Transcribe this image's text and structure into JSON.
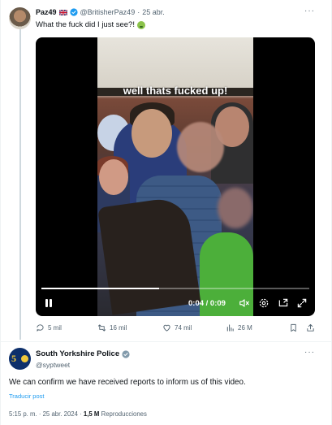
{
  "tweet1": {
    "display_name": "Paz49",
    "handle": "@BritisherPaz49",
    "separator": "·",
    "date": "25 abr.",
    "text": "What the fuck did I just see?!",
    "emoji": "nauseated-face",
    "video": {
      "caption": "well thats fucked up!",
      "time": "0:04 / 0:09",
      "progress": 0.44
    },
    "actions": {
      "replies": "5 mil",
      "retweets": "16 mil",
      "likes": "74 mil",
      "views": "26 M"
    }
  },
  "tweet2": {
    "display_name": "South Yorkshire Police",
    "handle": "@syptweet",
    "text": "We can confirm we have received reports to inform us of this video.",
    "translate_label": "Traducir post",
    "timestamp": "5:15 p. m. · 25 abr. 2024 ·",
    "views_count": "1,5 M",
    "views_label": "Reproducciones"
  },
  "colors": {
    "verified": "#1d9bf0",
    "secondary_text": "#536471",
    "link": "#1d9bf0"
  },
  "more_label": "···"
}
